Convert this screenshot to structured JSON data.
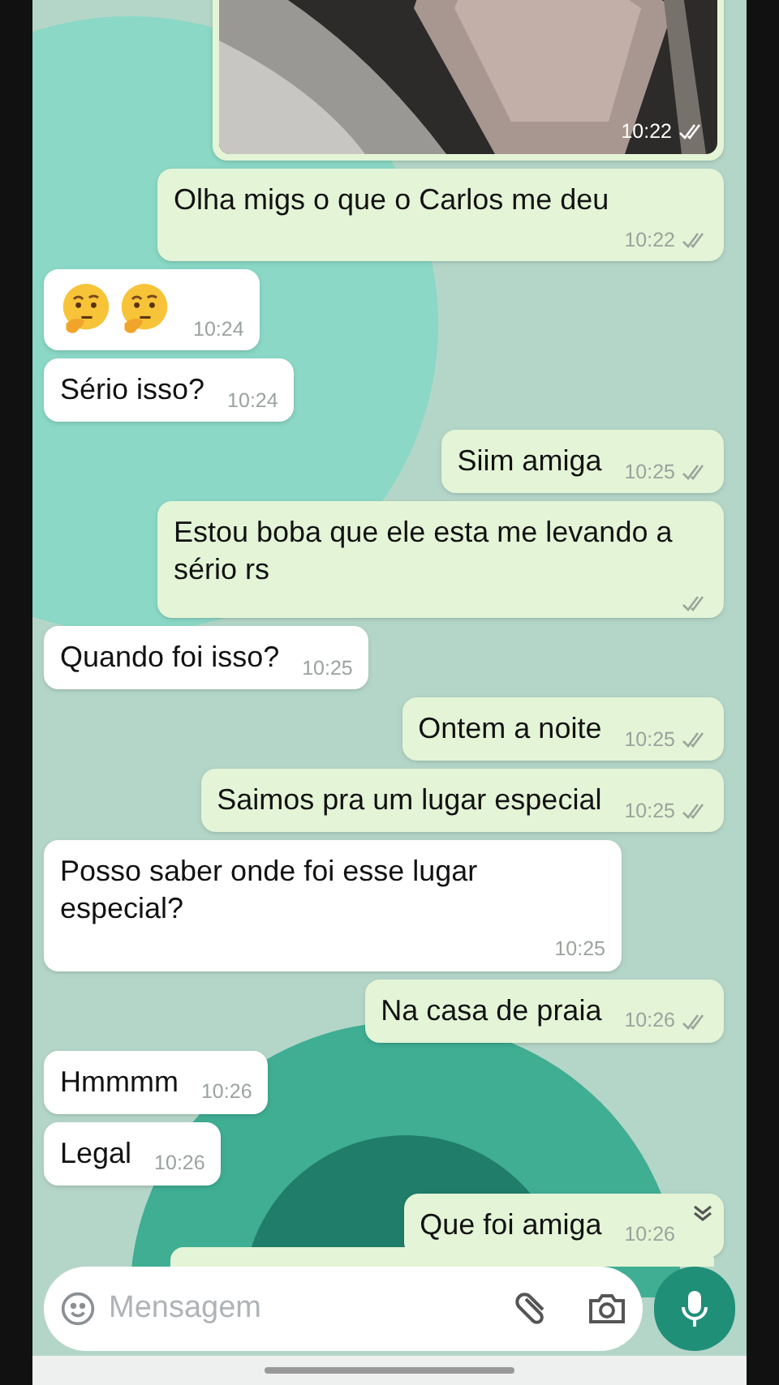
{
  "messages": [
    {
      "outgoing": true,
      "time": "10:22",
      "ticks": true,
      "chevron": false
    },
    {
      "kind": "text",
      "outgoing": true,
      "text": "Olha migs o que o Carlos me deu",
      "time": "10:22",
      "ticks": true,
      "chevron": false
    },
    {
      "kind": "emoji",
      "outgoing": false,
      "time": "10:24",
      "ticks": false,
      "chevron": false
    },
    {
      "kind": "text",
      "outgoing": false,
      "text": "Sério isso?",
      "time": "10:24",
      "ticks": false,
      "chevron": false
    },
    {
      "kind": "text",
      "outgoing": true,
      "text": "Siim amiga",
      "time": "10:25",
      "ticks": true,
      "chevron": false
    },
    {
      "kind": "text",
      "outgoing": true,
      "text": "Estou boba que ele esta me levando a sério rs",
      "ticks": true,
      "chevron": false
    },
    {
      "kind": "text",
      "outgoing": false,
      "text": "Quando foi isso?",
      "time": "10:25",
      "ticks": false,
      "chevron": false
    },
    {
      "kind": "text",
      "outgoing": true,
      "text": "Ontem a noite",
      "time": "10:25",
      "ticks": true,
      "chevron": false
    },
    {
      "kind": "text",
      "outgoing": true,
      "text": "Saimos pra um lugar especial",
      "time": "10:25",
      "ticks": true,
      "chevron": false
    },
    {
      "kind": "text",
      "outgoing": false,
      "text": "Posso saber onde foi esse lugar especial?",
      "time": "10:25",
      "ticks": false,
      "chevron": false
    },
    {
      "kind": "text",
      "outgoing": true,
      "text": "Na casa de praia",
      "time": "10:26",
      "ticks": true,
      "chevron": false
    },
    {
      "kind": "text",
      "outgoing": false,
      "text": "Hmmmm",
      "time": "10:26",
      "ticks": false,
      "chevron": false
    },
    {
      "kind": "text",
      "outgoing": false,
      "text": "Legal",
      "time": "10:26",
      "ticks": false,
      "chevron": false
    },
    {
      "kind": "text",
      "outgoing": true,
      "text": "Que foi amiga",
      "time": "10:26",
      "ticks": false,
      "chevron": true
    }
  ],
  "composer": {
    "placeholder": "Mensagem"
  }
}
